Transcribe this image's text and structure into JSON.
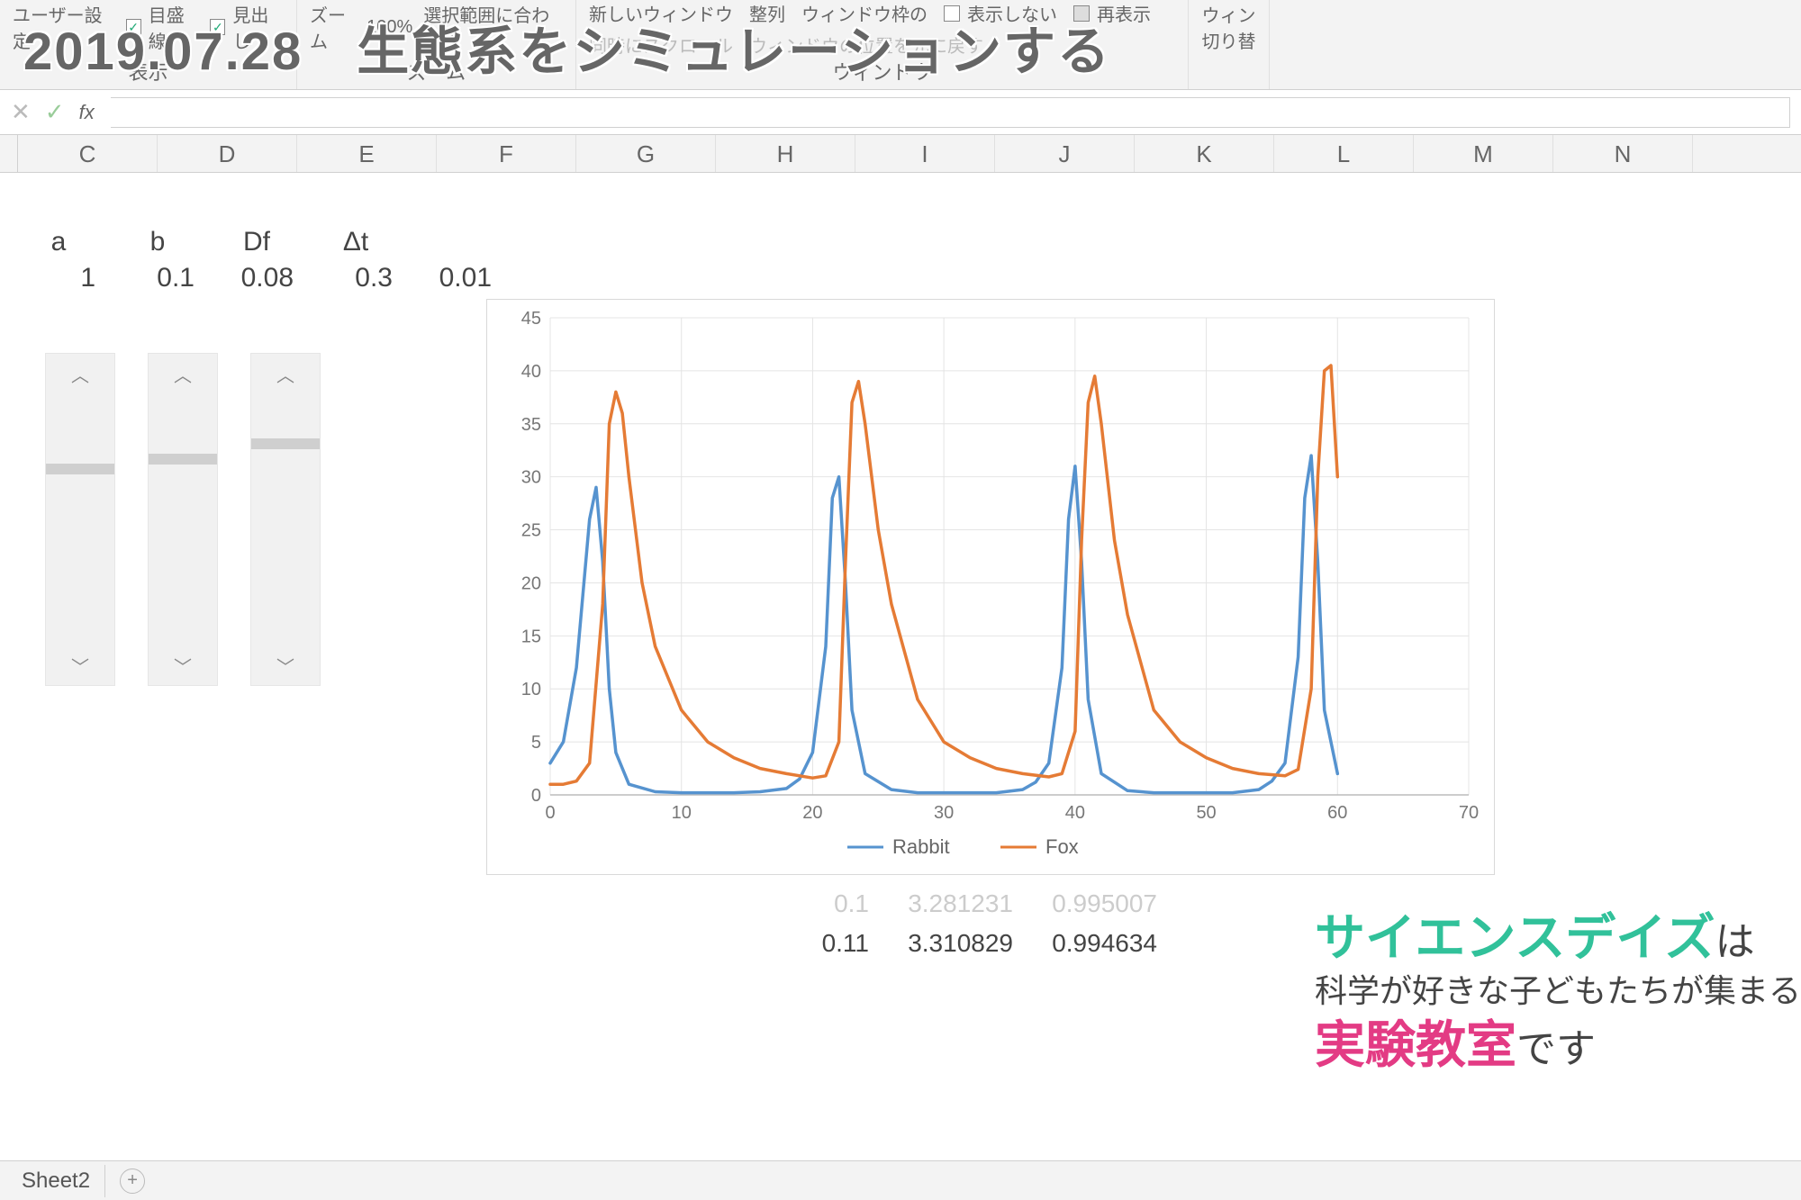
{
  "overlay_title": "2019.07.28　生態系をシミュレーションする",
  "ribbon": {
    "user_settings": "ユーザー設定",
    "gridlines": "目盛線",
    "headings": "見出し",
    "display_group": "表示",
    "zoom": "ズーム",
    "zoom100": "100%",
    "fit_selection": "選択範囲に合わせて",
    "zoom_group": "ズーム",
    "new_window": "新しいウィンドウ",
    "arrange": "整列",
    "freeze": "ウィンドウ枠の",
    "hide": "表示しない",
    "unhide": "再表示",
    "scroll_together": "同時にスクロール",
    "reset_pos": "ウィンドウの位置を元に戻す",
    "window_group": "ウィンドウ",
    "switch": "ウィン\n切り替"
  },
  "formula_bar": {
    "fx": "fx"
  },
  "columns": [
    "C",
    "D",
    "E",
    "F",
    "G",
    "H",
    "I",
    "J",
    "K",
    "L",
    "M",
    "N"
  ],
  "params": {
    "headers": [
      "a",
      "b",
      "Df",
      "Δt",
      ""
    ],
    "values_row_label": "",
    "values": [
      "1",
      "0.1",
      "0.08",
      "0.3",
      "0.01"
    ]
  },
  "slider_positions_pct": [
    28,
    24,
    18
  ],
  "under_data": {
    "rows": [
      [
        "0.1",
        "3.281231",
        "0.995007"
      ],
      [
        "0.11",
        "3.310829",
        "0.994634"
      ]
    ]
  },
  "tabs": {
    "active": "Sheet2"
  },
  "promo": {
    "line1_main": "サイエンスデイズ",
    "line1_suffix": "は",
    "line2": "科学が好きな子どもたちが集まる",
    "line3_main": "実験教室",
    "line3_suffix": "です"
  },
  "chart_data": {
    "type": "line",
    "xlabel": "",
    "ylabel": "",
    "xlim": [
      0,
      70
    ],
    "ylim": [
      0,
      45
    ],
    "xticks": [
      0,
      10,
      20,
      30,
      40,
      50,
      60,
      70
    ],
    "yticks": [
      0,
      5,
      10,
      15,
      20,
      25,
      30,
      35,
      40,
      45
    ],
    "legend": [
      "Rabbit",
      "Fox"
    ],
    "colors": {
      "Rabbit": "#5693cf",
      "Fox": "#e57b35"
    },
    "series": [
      {
        "name": "Rabbit",
        "x": [
          0,
          1,
          2,
          3,
          3.5,
          4,
          4.5,
          5,
          6,
          8,
          10,
          12,
          14,
          16,
          18,
          19,
          20,
          21,
          21.5,
          22,
          22.5,
          23,
          24,
          26,
          28,
          30,
          32,
          34,
          36,
          37,
          38,
          39,
          39.5,
          40,
          40.5,
          41,
          42,
          44,
          46,
          48,
          50,
          52,
          54,
          55,
          56,
          57,
          57.5,
          58,
          58.5,
          59,
          60
        ],
        "y": [
          3,
          5,
          12,
          26,
          29,
          22,
          10,
          4,
          1,
          0.3,
          0.2,
          0.2,
          0.2,
          0.3,
          0.6,
          1.5,
          4,
          14,
          28,
          30,
          20,
          8,
          2,
          0.5,
          0.2,
          0.2,
          0.2,
          0.2,
          0.5,
          1.2,
          3,
          12,
          26,
          31,
          22,
          9,
          2,
          0.4,
          0.2,
          0.2,
          0.2,
          0.2,
          0.5,
          1.3,
          3,
          13,
          28,
          32,
          22,
          8,
          2
        ]
      },
      {
        "name": "Fox",
        "x": [
          0,
          1,
          2,
          3,
          4,
          4.5,
          5,
          5.5,
          6,
          7,
          8,
          10,
          12,
          14,
          16,
          18,
          20,
          21,
          22,
          22.5,
          23,
          23.5,
          24,
          25,
          26,
          28,
          30,
          32,
          34,
          36,
          38,
          39,
          40,
          40.5,
          41,
          41.5,
          42,
          43,
          44,
          46,
          48,
          50,
          52,
          54,
          56,
          57,
          58,
          58.5,
          59,
          59.5,
          60
        ],
        "y": [
          1,
          1,
          1.3,
          3,
          18,
          35,
          38,
          36,
          30,
          20,
          14,
          8,
          5,
          3.5,
          2.5,
          2,
          1.6,
          1.8,
          5,
          22,
          37,
          39,
          35,
          25,
          18,
          9,
          5,
          3.5,
          2.5,
          2,
          1.7,
          2,
          6,
          24,
          37,
          39.5,
          35,
          24,
          17,
          8,
          5,
          3.5,
          2.5,
          2,
          1.8,
          2.4,
          10,
          30,
          40,
          40.5,
          30
        ]
      }
    ]
  }
}
